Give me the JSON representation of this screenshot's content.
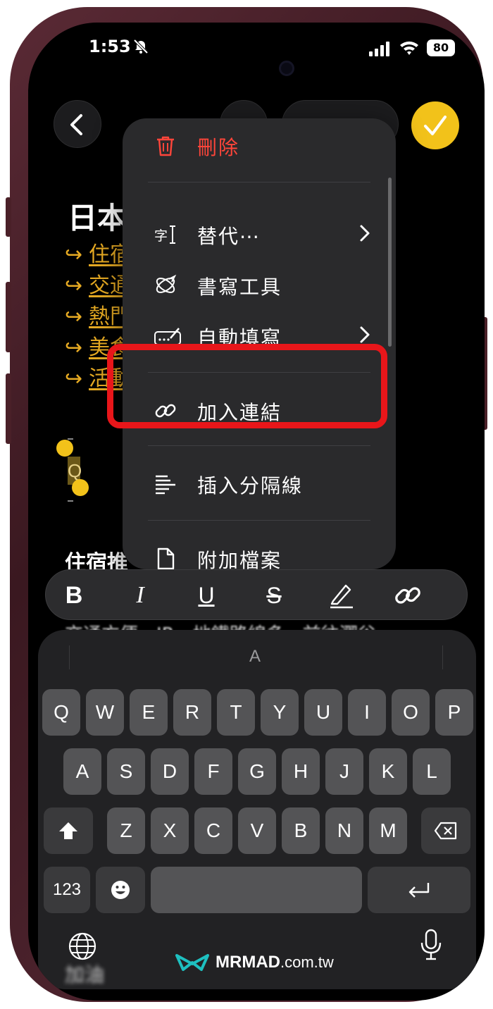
{
  "status_bar": {
    "time": "1:53",
    "battery": "80"
  },
  "note": {
    "title": "日本",
    "toc": [
      {
        "arrow": "↪",
        "text": "住宿"
      },
      {
        "arrow": "↪",
        "text": "交通"
      },
      {
        "arrow": "↪",
        "text": "熱門"
      },
      {
        "arrow": "↪",
        "text": "美食"
      },
      {
        "arrow": "↪",
        "text": "活動"
      }
    ],
    "selected_letter": "Q",
    "section_title": "住宿推",
    "body_line": "交通方便，JR、地鐵路線多，前往澀谷、",
    "blurred_text": "加油"
  },
  "menu": {
    "items": [
      {
        "label": "刪除",
        "icon": "trash-icon"
      },
      {
        "label": "替代⋯",
        "icon": "replace-text-icon"
      },
      {
        "label": "書寫工具",
        "icon": "writing-tools-icon"
      },
      {
        "label": "自動填寫",
        "icon": "autofill-icon"
      },
      {
        "label": "加入連結",
        "icon": "link-icon"
      },
      {
        "label": "插入分隔線",
        "icon": "divider-icon"
      },
      {
        "label": "附加檔案",
        "icon": "file-icon"
      }
    ],
    "delete_color": "#ff453a",
    "highlight_color": "#e8161a"
  },
  "format_bar": {
    "bold": "B",
    "italic": "I",
    "underline": "U",
    "strikethrough": "S"
  },
  "keyboard": {
    "suggestion": "A",
    "row1": [
      "Q",
      "W",
      "E",
      "R",
      "T",
      "Y",
      "U",
      "I",
      "O",
      "P"
    ],
    "row2": [
      "A",
      "S",
      "D",
      "F",
      "G",
      "H",
      "J",
      "K",
      "L"
    ],
    "row3": [
      "Z",
      "X",
      "C",
      "V",
      "B",
      "N",
      "M"
    ],
    "numbers_key": "123"
  },
  "watermark": {
    "name": "MRMAD",
    "tld": ".com.tw"
  },
  "accent_color": "#f2c21a"
}
